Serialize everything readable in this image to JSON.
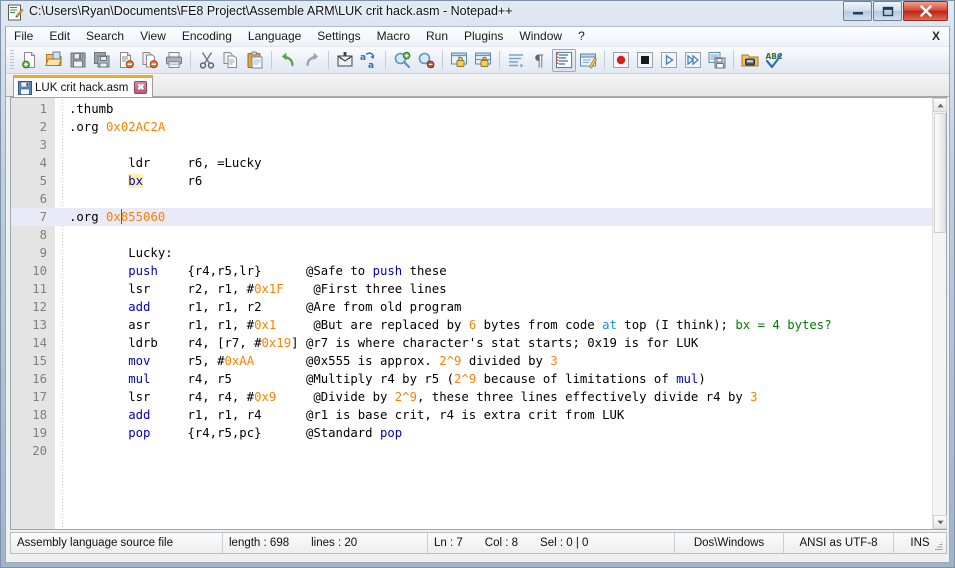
{
  "window": {
    "title": "C:\\Users\\Ryan\\Documents\\FE8 Project\\Assemble ARM\\LUK crit hack.asm - Notepad++",
    "minimize_label": "–",
    "maximize_label": "□",
    "close_label": "✕"
  },
  "menubar": {
    "items": [
      {
        "label": "File"
      },
      {
        "label": "Edit"
      },
      {
        "label": "Search"
      },
      {
        "label": "View"
      },
      {
        "label": "Encoding"
      },
      {
        "label": "Language"
      },
      {
        "label": "Settings"
      },
      {
        "label": "Macro"
      },
      {
        "label": "Run"
      },
      {
        "label": "Plugins"
      },
      {
        "label": "Window"
      },
      {
        "label": "?"
      }
    ],
    "doc_close_label": "X"
  },
  "toolbar": {
    "buttons": [
      {
        "name": "new-file-icon"
      },
      {
        "name": "open-file-icon"
      },
      {
        "name": "save-icon"
      },
      {
        "name": "save-all-icon"
      },
      {
        "name": "close-file-icon"
      },
      {
        "name": "close-all-files-icon"
      },
      {
        "name": "print-icon"
      },
      {
        "name": "separator"
      },
      {
        "name": "cut-icon"
      },
      {
        "name": "copy-icon"
      },
      {
        "name": "paste-icon"
      },
      {
        "name": "separator"
      },
      {
        "name": "undo-icon"
      },
      {
        "name": "redo-icon"
      },
      {
        "name": "separator"
      },
      {
        "name": "find-icon"
      },
      {
        "name": "replace-icon"
      },
      {
        "name": "separator"
      },
      {
        "name": "zoom-in-icon"
      },
      {
        "name": "zoom-out-icon"
      },
      {
        "name": "separator"
      },
      {
        "name": "sync-vertical-scroll-icon"
      },
      {
        "name": "sync-horizontal-scroll-icon"
      },
      {
        "name": "separator"
      },
      {
        "name": "word-wrap-icon"
      },
      {
        "name": "show-all-characters-icon"
      },
      {
        "name": "indent-guide-icon"
      },
      {
        "name": "user-defined-dialog-icon"
      },
      {
        "name": "separator"
      },
      {
        "name": "macro-record-icon"
      },
      {
        "name": "macro-stop-icon"
      },
      {
        "name": "macro-play-icon"
      },
      {
        "name": "macro-run-multiple-icon"
      },
      {
        "name": "macro-save-icon"
      },
      {
        "name": "separator"
      },
      {
        "name": "run-icon"
      },
      {
        "name": "spellcheck-icon"
      }
    ]
  },
  "tabs": [
    {
      "label": "LUK crit hack.asm",
      "close_label": "✖",
      "active": true
    }
  ],
  "editor": {
    "current_line": 7,
    "caret_line": 7,
    "caret_col_chars": 7,
    "highlighted_word": "bx",
    "lines": [
      {
        "n": "1",
        "tokens": [
          {
            "t": ".thumb",
            "c": "plain"
          }
        ]
      },
      {
        "n": "2",
        "tokens": [
          {
            "t": ".org ",
            "c": "plain"
          },
          {
            "t": "0x02AC2A",
            "c": "num"
          }
        ]
      },
      {
        "n": "3",
        "tokens": []
      },
      {
        "n": "4",
        "tokens": [
          {
            "t": "        ldr     r6, =Lucky",
            "c": "plain"
          }
        ]
      },
      {
        "n": "5",
        "tokens": [
          {
            "t": "        ",
            "c": "plain"
          },
          {
            "t": "bx",
            "c": "kw",
            "hl": true
          },
          {
            "t": "      r6",
            "c": "plain"
          }
        ]
      },
      {
        "n": "6",
        "tokens": []
      },
      {
        "n": "7",
        "tokens": [
          {
            "t": ".org ",
            "c": "plain"
          },
          {
            "t": "0x855060",
            "c": "num"
          }
        ]
      },
      {
        "n": "8",
        "tokens": []
      },
      {
        "n": "9",
        "tokens": [
          {
            "t": "        Lucky:",
            "c": "plain"
          }
        ]
      },
      {
        "n": "10",
        "tokens": [
          {
            "t": "        ",
            "c": "plain"
          },
          {
            "t": "push",
            "c": "kw"
          },
          {
            "t": "    {r4,r5,lr}      ",
            "c": "plain"
          },
          {
            "t": "@Safe to ",
            "c": "cmt"
          },
          {
            "t": "push",
            "c": "cmt-kw"
          },
          {
            "t": " these",
            "c": "cmt"
          }
        ]
      },
      {
        "n": "11",
        "tokens": [
          {
            "t": "        lsr     r2, r1, #",
            "c": "plain"
          },
          {
            "t": "0x1F",
            "c": "num"
          },
          {
            "t": "    ",
            "c": "plain"
          },
          {
            "t": "@First three lines",
            "c": "cmt"
          }
        ]
      },
      {
        "n": "12",
        "tokens": [
          {
            "t": "        ",
            "c": "plain"
          },
          {
            "t": "add",
            "c": "kw"
          },
          {
            "t": "     r1, r1, r2      ",
            "c": "plain"
          },
          {
            "t": "@Are from old program",
            "c": "cmt"
          }
        ]
      },
      {
        "n": "13",
        "tokens": [
          {
            "t": "        asr     r1, r1, #",
            "c": "plain"
          },
          {
            "t": "0x1",
            "c": "num"
          },
          {
            "t": "     ",
            "c": "plain"
          },
          {
            "t": "@But are replaced by ",
            "c": "cmt"
          },
          {
            "t": "6",
            "c": "cmt-num"
          },
          {
            "t": " bytes from code ",
            "c": "cmt"
          },
          {
            "t": "at",
            "c": "cmt-dir"
          },
          {
            "t": " top (I think); ",
            "c": "cmt"
          },
          {
            "t": "bx = 4 bytes?",
            "c": "cmt-grn"
          }
        ]
      },
      {
        "n": "14",
        "tokens": [
          {
            "t": "        ldrb    r4, [r7, #",
            "c": "plain"
          },
          {
            "t": "0x19",
            "c": "num"
          },
          {
            "t": "] ",
            "c": "plain"
          },
          {
            "t": "@r7 is where character's stat starts; 0x19 is for LUK",
            "c": "cmt"
          }
        ]
      },
      {
        "n": "15",
        "tokens": [
          {
            "t": "        ",
            "c": "plain"
          },
          {
            "t": "mov",
            "c": "kw"
          },
          {
            "t": "     r5, #",
            "c": "plain"
          },
          {
            "t": "0xAA",
            "c": "num"
          },
          {
            "t": "       ",
            "c": "plain"
          },
          {
            "t": "@0x555 is approx. ",
            "c": "cmt"
          },
          {
            "t": "2^9",
            "c": "cmt-num"
          },
          {
            "t": " divided by ",
            "c": "cmt"
          },
          {
            "t": "3",
            "c": "cmt-num"
          }
        ]
      },
      {
        "n": "16",
        "tokens": [
          {
            "t": "        ",
            "c": "plain"
          },
          {
            "t": "mul",
            "c": "kw"
          },
          {
            "t": "     r4, r5          ",
            "c": "plain"
          },
          {
            "t": "@Multiply r4 by r5 (",
            "c": "cmt"
          },
          {
            "t": "2^9",
            "c": "cmt-num"
          },
          {
            "t": " because of limitations of ",
            "c": "cmt"
          },
          {
            "t": "mul",
            "c": "cmt-kw"
          },
          {
            "t": ")",
            "c": "cmt"
          }
        ]
      },
      {
        "n": "17",
        "tokens": [
          {
            "t": "        lsr     r4, r4, #",
            "c": "plain"
          },
          {
            "t": "0x9",
            "c": "num"
          },
          {
            "t": "     ",
            "c": "plain"
          },
          {
            "t": "@Divide by ",
            "c": "cmt"
          },
          {
            "t": "2^9",
            "c": "cmt-num"
          },
          {
            "t": ", these three lines effectively divide r4 by ",
            "c": "cmt"
          },
          {
            "t": "3",
            "c": "cmt-num"
          }
        ]
      },
      {
        "n": "18",
        "tokens": [
          {
            "t": "        ",
            "c": "plain"
          },
          {
            "t": "add",
            "c": "kw"
          },
          {
            "t": "     r1, r1, r4      ",
            "c": "plain"
          },
          {
            "t": "@r1 is base crit, r4 is extra crit from LUK",
            "c": "cmt"
          }
        ]
      },
      {
        "n": "19",
        "tokens": [
          {
            "t": "        ",
            "c": "plain"
          },
          {
            "t": "pop",
            "c": "kw"
          },
          {
            "t": "     {r4,r5,pc}      ",
            "c": "plain"
          },
          {
            "t": "@Standard ",
            "c": "cmt"
          },
          {
            "t": "pop",
            "c": "cmt-kw"
          }
        ]
      },
      {
        "n": "20",
        "tokens": []
      }
    ]
  },
  "statusbar": {
    "doc_type": "Assembly language source file",
    "length_label": "length : 698",
    "lines_label": "lines : 20",
    "ln_label": "Ln : 7",
    "col_label": "Col : 8",
    "sel_label": "Sel : 0 | 0",
    "eol_label": "Dos\\Windows",
    "encoding_label": "ANSI as UTF-8",
    "insert_mode_label": "INS"
  },
  "colors": {
    "keyword": "#0000d0",
    "number": "#ff8000",
    "comment": "#000000",
    "comment_green": "#008000",
    "comment_directive": "#1e90d8",
    "current_line_bg": "#e8eaf8",
    "word_highlight_bg": "#fff2a8",
    "tab_active_top": "#f0a92e",
    "caret": "#7d32d8"
  }
}
